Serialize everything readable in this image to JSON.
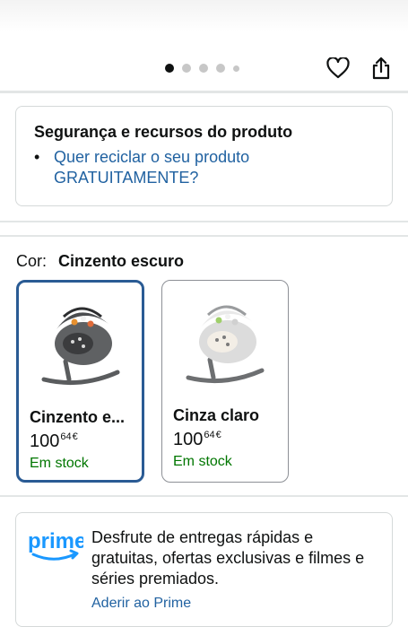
{
  "carousel": {
    "dot_count": 5,
    "active_index": 0
  },
  "actions": {
    "wishlist_icon": "heart-icon",
    "share_icon": "share-icon"
  },
  "safety": {
    "title": "Segurança e recursos do produto",
    "link_text": "Quer reciclar o seu produto GRATUITAMENTE?"
  },
  "color_selector": {
    "label": "Cor:",
    "selected_value": "Cinzento escuro",
    "options": [
      {
        "name": "Cinzento escuro",
        "display_name": "Cinzento e...",
        "price_whole": "100",
        "price_fraction": "64",
        "currency": "€",
        "availability": "Em stock",
        "selected": true
      },
      {
        "name": "Cinza claro",
        "display_name": "Cinza claro",
        "price_whole": "100",
        "price_fraction": "64",
        "currency": "€",
        "availability": "Em stock",
        "selected": false
      }
    ]
  },
  "prime": {
    "logo_text": "prime",
    "description": "Desfrute de entregas rápidas e gratuitas, ofertas exclusivas e filmes e séries premiados.",
    "cta": "Aderir ao Prime"
  },
  "colors": {
    "link": "#2162a1",
    "stock": "#007600",
    "selected_border": "#2a5b94",
    "prime_blue": "#1a98ff"
  }
}
